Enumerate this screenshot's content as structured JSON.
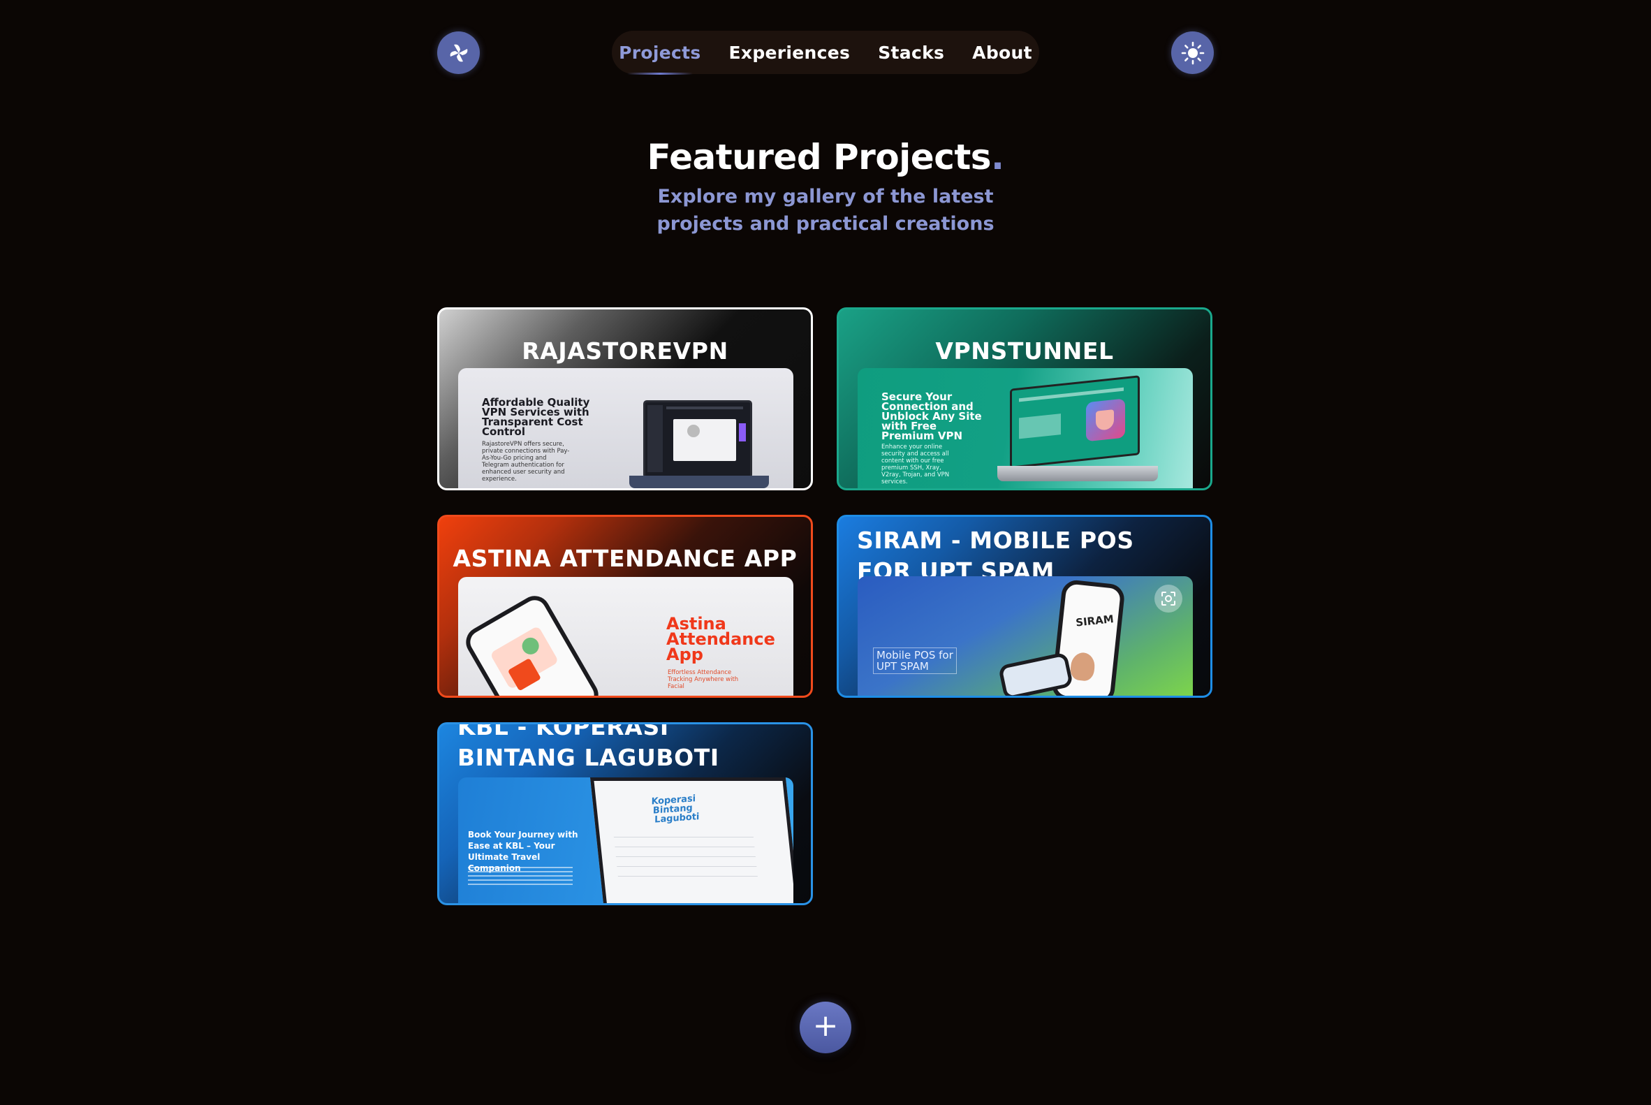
{
  "header": {
    "logo_icon": "pinwheel-logo-icon",
    "theme_toggle_icon": "sun-icon",
    "nav": [
      {
        "label": "Projects",
        "active": true
      },
      {
        "label": "Experiences",
        "active": false
      },
      {
        "label": "Stacks",
        "active": false
      },
      {
        "label": "About",
        "active": false
      }
    ]
  },
  "hero": {
    "title": "Featured Projects",
    "title_dot": ".",
    "subtitle": "Explore my gallery of the latest projects and practical creations"
  },
  "projects": [
    {
      "title": "RAJASTOREVPN",
      "accent": "#ffffff",
      "preview_headline": "Affordable Quality VPN Services with Transparent Cost Control",
      "preview_body": "RajastoreVPN offers secure, private connections with Pay-As-You-Go pricing and Telegram authentication for enhanced user security and experience."
    },
    {
      "title": "VPNSTUNNEL",
      "accent": "#1aa88c",
      "preview_headline": "Secure Your Connection and Unblock Any Site with Free Premium VPN",
      "preview_body": "Enhance your online security and access all content with our free premium SSH, Xray, V2ray, Trojan, and VPN services."
    },
    {
      "title": "ASTINA ATTENDANCE APP",
      "accent": "#f04a1c",
      "preview_headline": "Astina Attendance App",
      "preview_body": "Effortless Attendance Tracking Anywhere with Facial"
    },
    {
      "title": "SIRAM - MOBILE POS FOR UPT SPAM",
      "accent": "#1e8de6",
      "preview_headline": "Mobile POS for UPT SPAM",
      "preview_phone_text": "SIRAM",
      "overlay_icon": "scan-icon"
    },
    {
      "title": "KBL - KOPERASI BINTANG LAGUBOTI",
      "accent": "#2a92e6",
      "preview_headline": "Book Your Journey with Ease at KBL – Your Ultimate Travel Companion",
      "preview_brand": "Koperasi Bintang Laguboti"
    }
  ],
  "fab": {
    "icon": "plus-icon",
    "label": "+"
  }
}
